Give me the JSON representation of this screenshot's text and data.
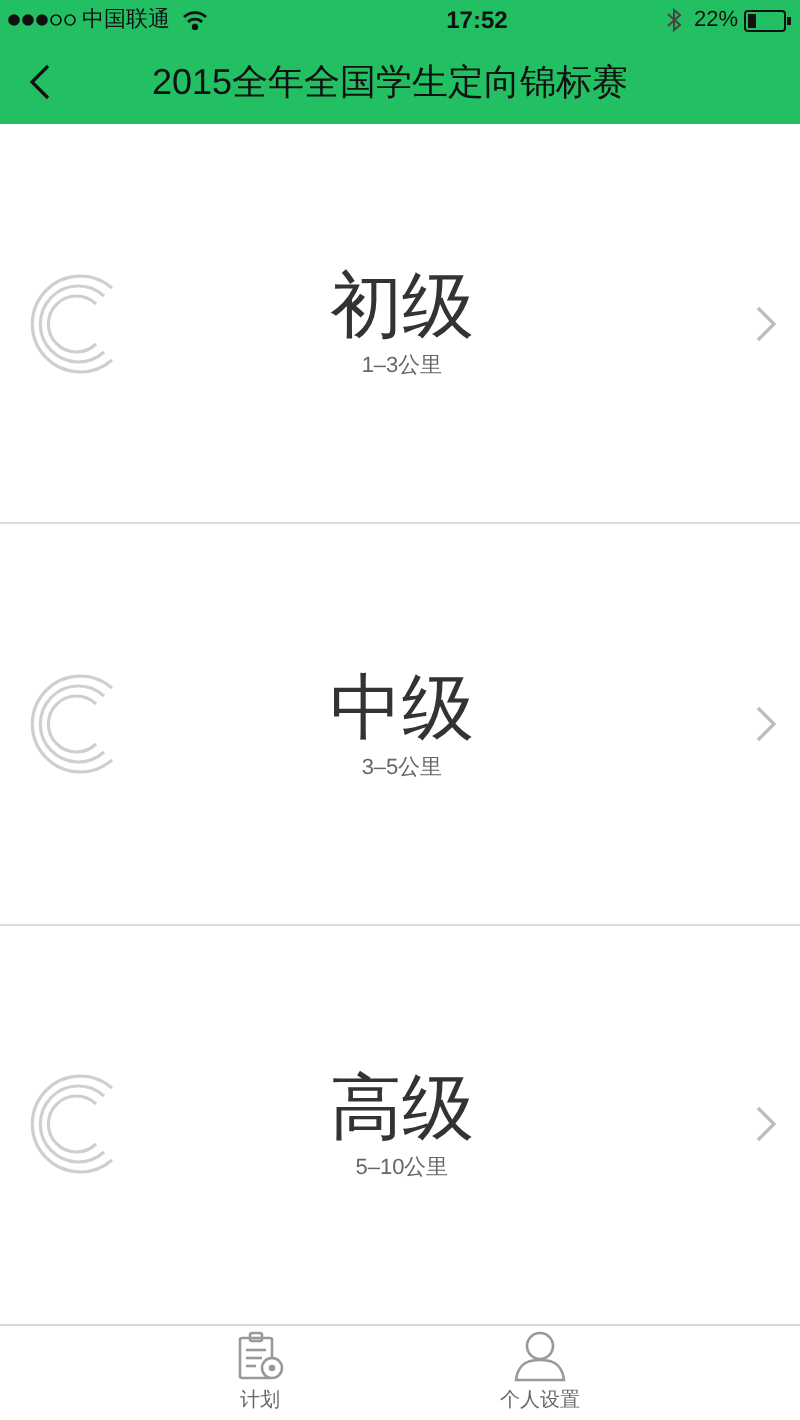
{
  "status_bar": {
    "carrier": "中国联通",
    "time": "17:52",
    "battery": "22%"
  },
  "nav": {
    "title": "2015全年全国学生定向锦标赛"
  },
  "levels": [
    {
      "title": "初级",
      "distance": "1–3公里"
    },
    {
      "title": "中级",
      "distance": "3–5公里"
    },
    {
      "title": "高级",
      "distance": "5–10公里"
    }
  ],
  "tabs": [
    {
      "label": "计划",
      "kind": "plan",
      "selected": false
    },
    {
      "label": "个人设置",
      "kind": "person",
      "selected": false
    }
  ]
}
